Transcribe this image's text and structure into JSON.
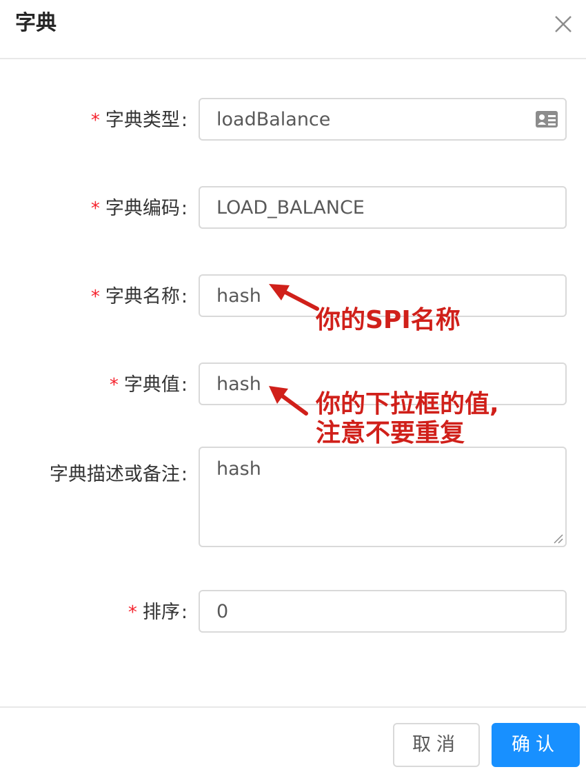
{
  "dialog": {
    "title": "字典",
    "close_icon": "close-icon"
  },
  "form": {
    "required_mark": "*",
    "colon": ":",
    "fields": [
      {
        "label": "字典类型",
        "value": "loadBalance",
        "required": true,
        "icon": "id-card-icon"
      },
      {
        "label": "字典编码",
        "value": "LOAD_BALANCE",
        "required": true
      },
      {
        "label": "字典名称",
        "value": "hash",
        "required": true
      },
      {
        "label": "字典值",
        "value": "hash",
        "required": true
      },
      {
        "label": "字典描述或备注",
        "value": "hash",
        "required": false
      },
      {
        "label": "排序",
        "value": "0",
        "required": true
      }
    ]
  },
  "annotations": {
    "name_note": "你的SPI名称",
    "value_note_line1": "你的下拉框的值,",
    "value_note_line2": "注意不要重复",
    "color": "#d0201a"
  },
  "footer": {
    "cancel_label": "取消",
    "ok_label": "确认"
  },
  "colors": {
    "primary": "#1890ff",
    "required": "#f5222d",
    "border": "#d9d9d9"
  }
}
